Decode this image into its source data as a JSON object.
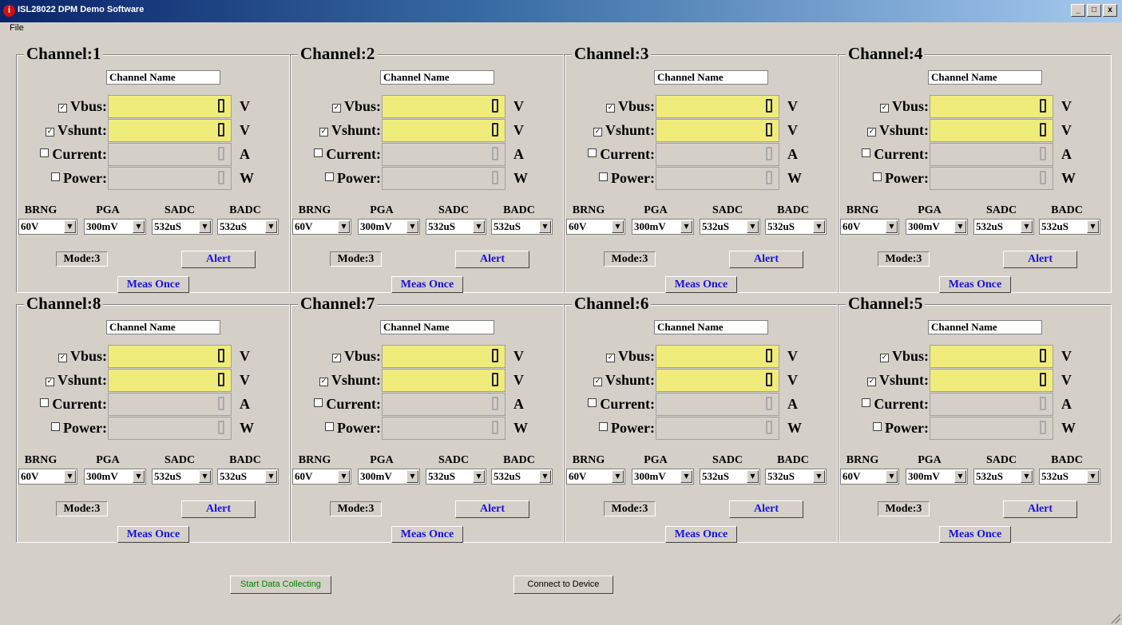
{
  "window": {
    "title": "ISL28022 DPM Demo Software",
    "icon": "info-icon",
    "minimize": "_",
    "maximize": "□",
    "close": "x"
  },
  "menu": {
    "file": "File"
  },
  "channel_name_placeholder": "Channel Name",
  "channels": [
    {
      "title": "Channel:1",
      "name": "Channel Name"
    },
    {
      "title": "Channel:2",
      "name": "Channel Name"
    },
    {
      "title": "Channel:3",
      "name": "Channel Name"
    },
    {
      "title": "Channel:4",
      "name": "Channel Name"
    },
    {
      "title": "Channel:8",
      "name": "Channel Name"
    },
    {
      "title": "Channel:7",
      "name": "Channel Name"
    },
    {
      "title": "Channel:6",
      "name": "Channel Name"
    },
    {
      "title": "Channel:5",
      "name": "Channel Name"
    }
  ],
  "measurements": [
    {
      "label": "Vbus:",
      "unit": "V",
      "checked": true,
      "check_glyph": "✓"
    },
    {
      "label": "Vshunt:",
      "unit": "V",
      "checked": true,
      "check_glyph": "✓"
    },
    {
      "label": "Current:",
      "unit": "A",
      "checked": false,
      "check_glyph": ""
    },
    {
      "label": "Power:",
      "unit": "W",
      "checked": false,
      "check_glyph": ""
    }
  ],
  "selectors": [
    {
      "label": "BRNG",
      "value": "60V"
    },
    {
      "label": "PGA",
      "value": "300mV"
    },
    {
      "label": "SADC",
      "value": "532uS"
    },
    {
      "label": "BADC",
      "value": "532uS"
    }
  ],
  "mode_label": "Mode:3",
  "alert_label": "Alert",
  "meas_once_label": "Meas Once",
  "buttons": {
    "start": "Start Data Collecting",
    "connect": "Connect to Device"
  },
  "colors": {
    "meter_active": "#f0ec7c",
    "link_text": "#1a10e0",
    "start_text": "#008000"
  }
}
